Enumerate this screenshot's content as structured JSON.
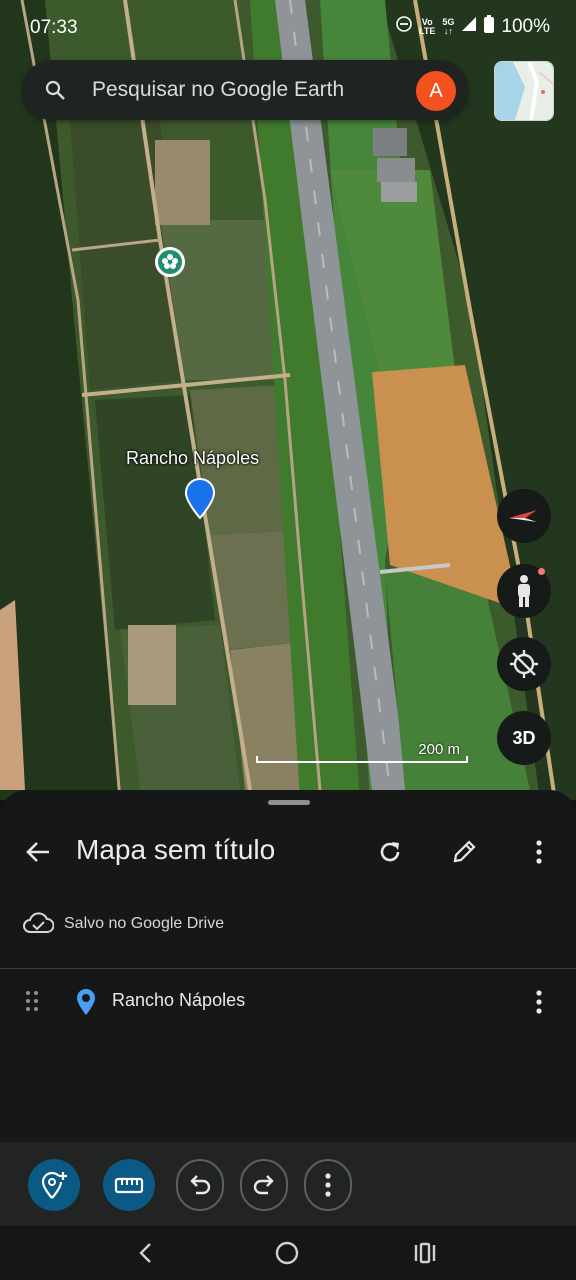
{
  "status_bar": {
    "time": "07:33",
    "battery": "100%",
    "volte_top": "Vo",
    "volte_bottom": "LTE",
    "network_top": "5G",
    "network_bottom": "↓↑"
  },
  "search": {
    "placeholder": "Pesquisar no Google Earth",
    "avatar_letter": "A"
  },
  "map": {
    "place_label": "Rancho Nápoles",
    "scale_label": "200 m",
    "button_3d": "3D"
  },
  "sheet": {
    "title": "Mapa sem título",
    "save_status": "Salvo no Google Drive",
    "items": [
      {
        "label": "Rancho Nápoles"
      }
    ]
  },
  "colors": {
    "accent": "#0b5a86",
    "avatar": "#f4511e",
    "pin": "#1a73e8",
    "sheet_bg": "#161717"
  }
}
